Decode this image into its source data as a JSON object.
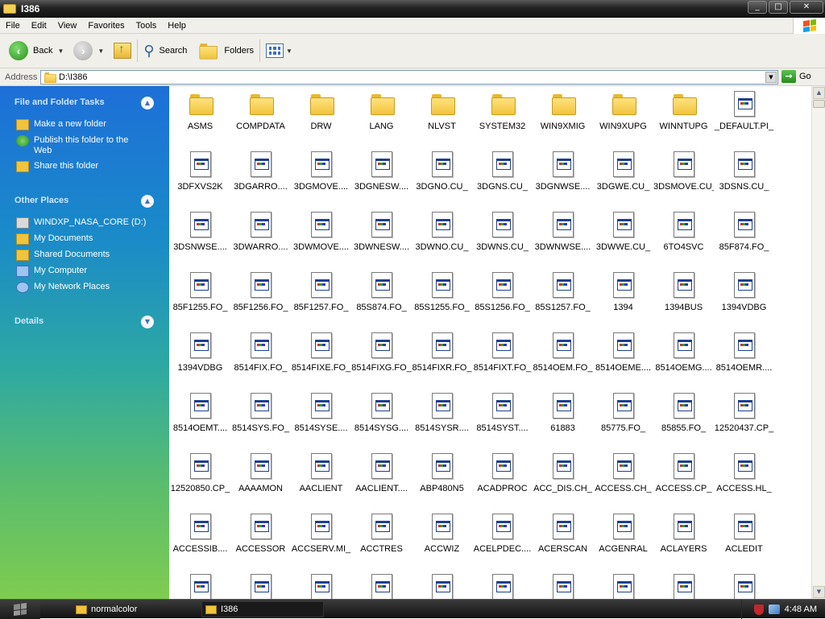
{
  "window": {
    "title": "I386",
    "controls": [
      "minimize",
      "maximize",
      "close"
    ]
  },
  "menu": [
    "File",
    "Edit",
    "View",
    "Favorites",
    "Tools",
    "Help"
  ],
  "toolbar": {
    "back_label": "Back",
    "search_label": "Search",
    "folders_label": "Folders"
  },
  "address": {
    "label": "Address",
    "value": "D:\\I386",
    "go_label": "Go"
  },
  "sidebar": {
    "tasks_title": "File and Folder Tasks",
    "tasks": [
      {
        "label": "Make a new folder",
        "icon": "new-folder-icon"
      },
      {
        "label": "Publish this folder to the Web",
        "icon": "publish-web-icon"
      },
      {
        "label": "Share this folder",
        "icon": "share-folder-icon"
      }
    ],
    "places_title": "Other Places",
    "places": [
      {
        "label": "WINDXP_NASA_CORE (D:)",
        "icon": "drive-icon"
      },
      {
        "label": "My Documents",
        "icon": "my-documents-icon"
      },
      {
        "label": "Shared Documents",
        "icon": "shared-documents-icon"
      },
      {
        "label": "My Computer",
        "icon": "my-computer-icon"
      },
      {
        "label": "My Network Places",
        "icon": "network-places-icon"
      }
    ],
    "details_title": "Details"
  },
  "files": [
    {
      "name": "ASMS",
      "type": "folder"
    },
    {
      "name": "COMPDATA",
      "type": "folder"
    },
    {
      "name": "DRW",
      "type": "folder"
    },
    {
      "name": "LANG",
      "type": "folder"
    },
    {
      "name": "NLVST",
      "type": "folder"
    },
    {
      "name": "SYSTEM32",
      "type": "folder"
    },
    {
      "name": "WIN9XMIG",
      "type": "folder"
    },
    {
      "name": "WIN9XUPG",
      "type": "folder"
    },
    {
      "name": "WINNTUPG",
      "type": "folder"
    },
    {
      "name": "_DEFAULT.PI_",
      "type": "file"
    },
    {
      "name": "3DFXVS2K",
      "type": "file"
    },
    {
      "name": "3DGARRO....",
      "type": "file"
    },
    {
      "name": "3DGMOVE....",
      "type": "file"
    },
    {
      "name": "3DGNESW....",
      "type": "file"
    },
    {
      "name": "3DGNO.CU_",
      "type": "file"
    },
    {
      "name": "3DGNS.CU_",
      "type": "file"
    },
    {
      "name": "3DGNWSE....",
      "type": "file"
    },
    {
      "name": "3DGWE.CU_",
      "type": "file"
    },
    {
      "name": "3DSMOVE.CU_",
      "type": "file"
    },
    {
      "name": "3DSNS.CU_",
      "type": "file"
    },
    {
      "name": "3DSNWSE....",
      "type": "file"
    },
    {
      "name": "3DWARRO....",
      "type": "file"
    },
    {
      "name": "3DWMOVE....",
      "type": "file"
    },
    {
      "name": "3DWNESW....",
      "type": "file"
    },
    {
      "name": "3DWNO.CU_",
      "type": "file"
    },
    {
      "name": "3DWNS.CU_",
      "type": "file"
    },
    {
      "name": "3DWNWSE....",
      "type": "file"
    },
    {
      "name": "3DWWE.CU_",
      "type": "file"
    },
    {
      "name": "6TO4SVC",
      "type": "file"
    },
    {
      "name": "85F874.FO_",
      "type": "file"
    },
    {
      "name": "85F1255.FO_",
      "type": "file"
    },
    {
      "name": "85F1256.FO_",
      "type": "file"
    },
    {
      "name": "85F1257.FO_",
      "type": "file"
    },
    {
      "name": "85S874.FO_",
      "type": "file"
    },
    {
      "name": "85S1255.FO_",
      "type": "file"
    },
    {
      "name": "85S1256.FO_",
      "type": "file"
    },
    {
      "name": "85S1257.FO_",
      "type": "file"
    },
    {
      "name": "1394",
      "type": "file"
    },
    {
      "name": "1394BUS",
      "type": "file"
    },
    {
      "name": "1394VDBG",
      "type": "file"
    },
    {
      "name": "1394VDBG",
      "type": "file"
    },
    {
      "name": "8514FIX.FO_",
      "type": "file"
    },
    {
      "name": "8514FIXE.FO_",
      "type": "file"
    },
    {
      "name": "8514FIXG.FO_",
      "type": "file"
    },
    {
      "name": "8514FIXR.FO_",
      "type": "file"
    },
    {
      "name": "8514FIXT.FO_",
      "type": "file"
    },
    {
      "name": "8514OEM.FO_",
      "type": "file"
    },
    {
      "name": "8514OEME....",
      "type": "file"
    },
    {
      "name": "8514OEMG....",
      "type": "file"
    },
    {
      "name": "8514OEMR....",
      "type": "file"
    },
    {
      "name": "8514OEMT....",
      "type": "file"
    },
    {
      "name": "8514SYS.FO_",
      "type": "file"
    },
    {
      "name": "8514SYSE....",
      "type": "file"
    },
    {
      "name": "8514SYSG....",
      "type": "file"
    },
    {
      "name": "8514SYSR....",
      "type": "file"
    },
    {
      "name": "8514SYST....",
      "type": "file"
    },
    {
      "name": "61883",
      "type": "file"
    },
    {
      "name": "85775.FO_",
      "type": "file"
    },
    {
      "name": "85855.FO_",
      "type": "file"
    },
    {
      "name": "12520437.CP_",
      "type": "file"
    },
    {
      "name": "12520850.CP_",
      "type": "file"
    },
    {
      "name": "AAAAMON",
      "type": "file"
    },
    {
      "name": "AACLIENT",
      "type": "file"
    },
    {
      "name": "AACLIENT....",
      "type": "file"
    },
    {
      "name": "ABP480N5",
      "type": "file"
    },
    {
      "name": "ACADPROC",
      "type": "file"
    },
    {
      "name": "ACC_DIS.CH_",
      "type": "file"
    },
    {
      "name": "ACCESS.CH_",
      "type": "file"
    },
    {
      "name": "ACCESS.CP_",
      "type": "file"
    },
    {
      "name": "ACCESS.HL_",
      "type": "file"
    },
    {
      "name": "ACCESSIB....",
      "type": "file"
    },
    {
      "name": "ACCESSOR",
      "type": "file"
    },
    {
      "name": "ACCSERV.MI_",
      "type": "file"
    },
    {
      "name": "ACCTRES",
      "type": "file"
    },
    {
      "name": "ACCWIZ",
      "type": "file"
    },
    {
      "name": "ACELPDEC....",
      "type": "file"
    },
    {
      "name": "ACERSCAN",
      "type": "file"
    },
    {
      "name": "ACGENRAL",
      "type": "file"
    },
    {
      "name": "ACLAYERS",
      "type": "file"
    },
    {
      "name": "ACLEDIT",
      "type": "file"
    },
    {
      "name": "",
      "type": "file"
    },
    {
      "name": "",
      "type": "file"
    },
    {
      "name": "",
      "type": "file"
    },
    {
      "name": "",
      "type": "file"
    },
    {
      "name": "",
      "type": "file"
    },
    {
      "name": "",
      "type": "file"
    },
    {
      "name": "",
      "type": "file"
    },
    {
      "name": "",
      "type": "file"
    },
    {
      "name": "",
      "type": "file"
    },
    {
      "name": "",
      "type": "file"
    }
  ],
  "taskbar": {
    "tasks": [
      {
        "label": "normalcolor",
        "active": false
      },
      {
        "label": "I386",
        "active": true
      }
    ],
    "clock": "4:48 AM"
  },
  "colors": {
    "sidebar_top": "#1d6fd8",
    "sidebar_bottom": "#7fcc4f",
    "titlebar": "#222222",
    "folder": "#f1c43c"
  }
}
